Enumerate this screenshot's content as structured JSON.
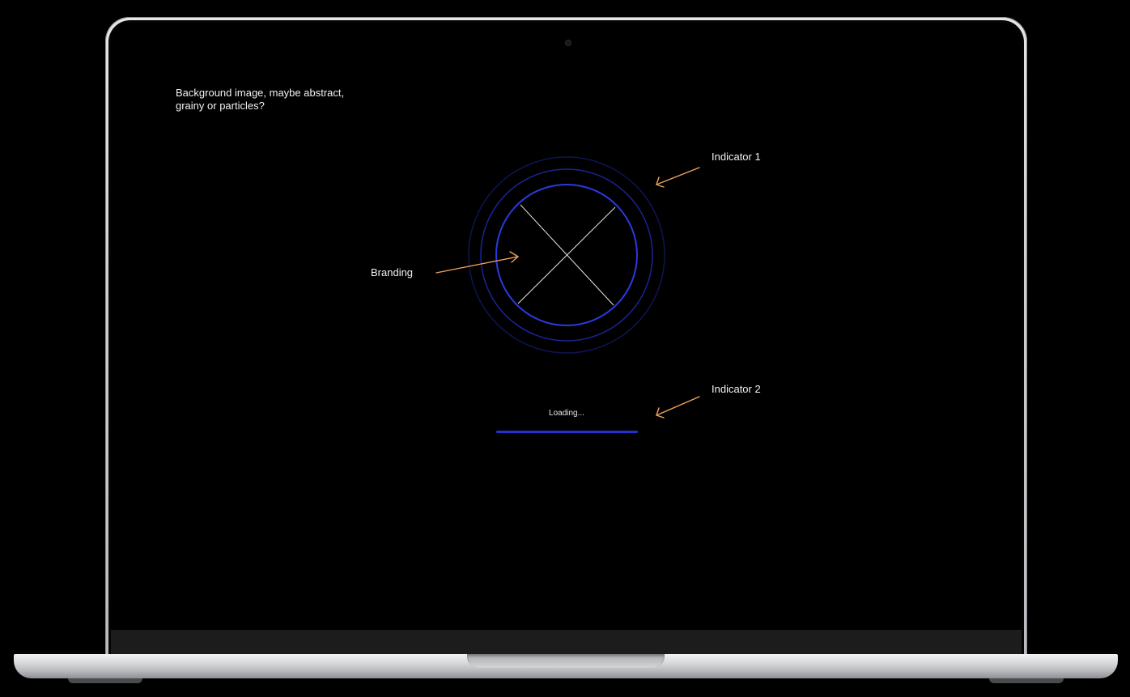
{
  "screen": {
    "background_note": "Background image, maybe abstract, grainy or particles?",
    "loading_text": "Loading...",
    "progress": 1.0
  },
  "annotations": {
    "branding": "Branding",
    "indicator_1": "Indicator 1",
    "indicator_2": "Indicator 2"
  },
  "colors": {
    "ring_primary": "#2a3ae0",
    "ring_mid": "#1a2493",
    "ring_outer": "#0e1550",
    "annotation_arrow": "#f0a35c",
    "placeholder_lines": "#e6e6e6"
  },
  "icons": {
    "logo_placeholder": "crossed-circle-placeholder"
  }
}
